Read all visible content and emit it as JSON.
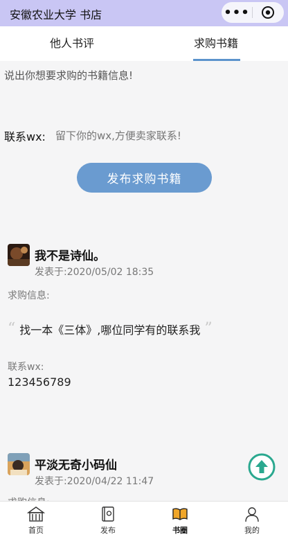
{
  "header": {
    "title": "安徽农业大学 书店",
    "more_icon": "more-dots-icon",
    "close_icon": "target-close-icon"
  },
  "tabs": [
    {
      "label": "他人书评",
      "active": false
    },
    {
      "label": "求购书籍",
      "active": true
    }
  ],
  "form": {
    "hint": "说出你想要求购的书籍信息!",
    "wx_label": "联系wx:",
    "wx_placeholder": "留下你的wx,方便卖家联系!",
    "submit_label": "发布求购书籍"
  },
  "posts": [
    {
      "name": "我不是诗仙。",
      "date": "发表于:2020/05/02 18:35",
      "request_label": "求购信息:",
      "request_text": "找一本《三体》,哪位同学有的联系我",
      "wx_label": "联系wx:",
      "wx_value": "123456789"
    },
    {
      "name": "平淡无奇小码仙",
      "date": "发表于:2020/04/22 11:47",
      "request_label": "求购信息:"
    }
  ],
  "colors": {
    "accent": "#5b93cc",
    "button": "#6a9bd0",
    "header_bg": "#c9c6f4",
    "fab": "#2aa88f"
  },
  "bottom_nav": [
    {
      "label": "首页",
      "icon": "building-icon",
      "active": false
    },
    {
      "label": "发布",
      "icon": "book-publish-icon",
      "active": false
    },
    {
      "label": "书圈",
      "icon": "open-book-icon",
      "active": true
    },
    {
      "label": "我的",
      "icon": "user-icon",
      "active": false
    }
  ]
}
